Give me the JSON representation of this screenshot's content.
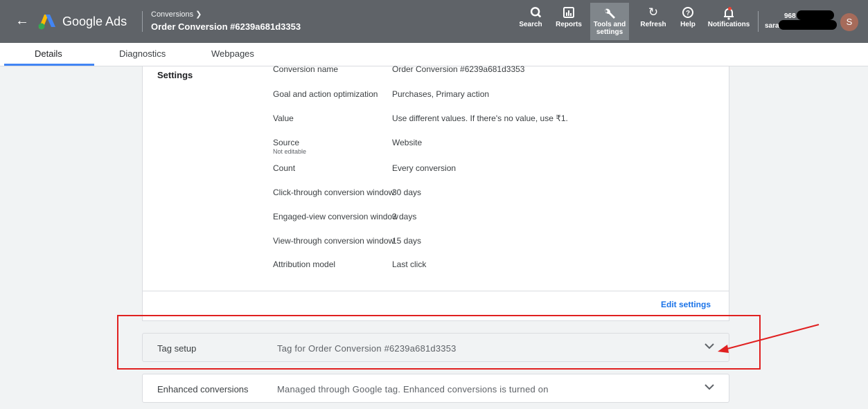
{
  "header": {
    "brand": "Google Ads",
    "breadcrumb": "Conversions",
    "title": "Order Conversion #6239a681d3353",
    "tools": [
      {
        "label": "Search",
        "icon": "search-icon"
      },
      {
        "label": "Reports",
        "icon": "reports-icon"
      },
      {
        "label": "Tools and settings",
        "icon": "wrench-icon"
      },
      {
        "label": "Refresh",
        "icon": "refresh-icon"
      },
      {
        "label": "Help",
        "icon": "help-icon"
      },
      {
        "label": "Notifications",
        "icon": "bell-icon"
      }
    ],
    "account_id": "968",
    "account_user": "sarat",
    "avatar_letter": "S"
  },
  "tabs": [
    {
      "label": "Details"
    },
    {
      "label": "Diagnostics"
    },
    {
      "label": "Webpages"
    }
  ],
  "settings": {
    "heading": "Settings",
    "rows": [
      {
        "label": "Conversion name",
        "value": "Order Conversion #6239a681d3353"
      },
      {
        "label": "Goal and action optimization",
        "value": "Purchases, Primary action"
      },
      {
        "label": "Value",
        "value": "Use different values. If there's no value, use ₹1."
      },
      {
        "label": "Source",
        "sub": "Not editable",
        "value": "Website"
      },
      {
        "label": "Count",
        "value": "Every conversion"
      },
      {
        "label": "Click-through conversion window",
        "value": "30 days"
      },
      {
        "label": "Engaged-view conversion window",
        "value": "3 days"
      },
      {
        "label": "View-through conversion window",
        "value": "15 days"
      },
      {
        "label": "Attribution model",
        "value": "Last click"
      }
    ],
    "edit_label": "Edit settings"
  },
  "panels": {
    "tag_setup": {
      "name": "Tag setup",
      "desc": "Tag for Order Conversion #6239a681d3353"
    },
    "enhanced": {
      "name": "Enhanced conversions",
      "desc": "Managed through Google tag. Enhanced conversions is turned on"
    }
  },
  "colors": {
    "header": "#5f6368",
    "accent": "#1a73e8",
    "annotation": "#e02020"
  }
}
